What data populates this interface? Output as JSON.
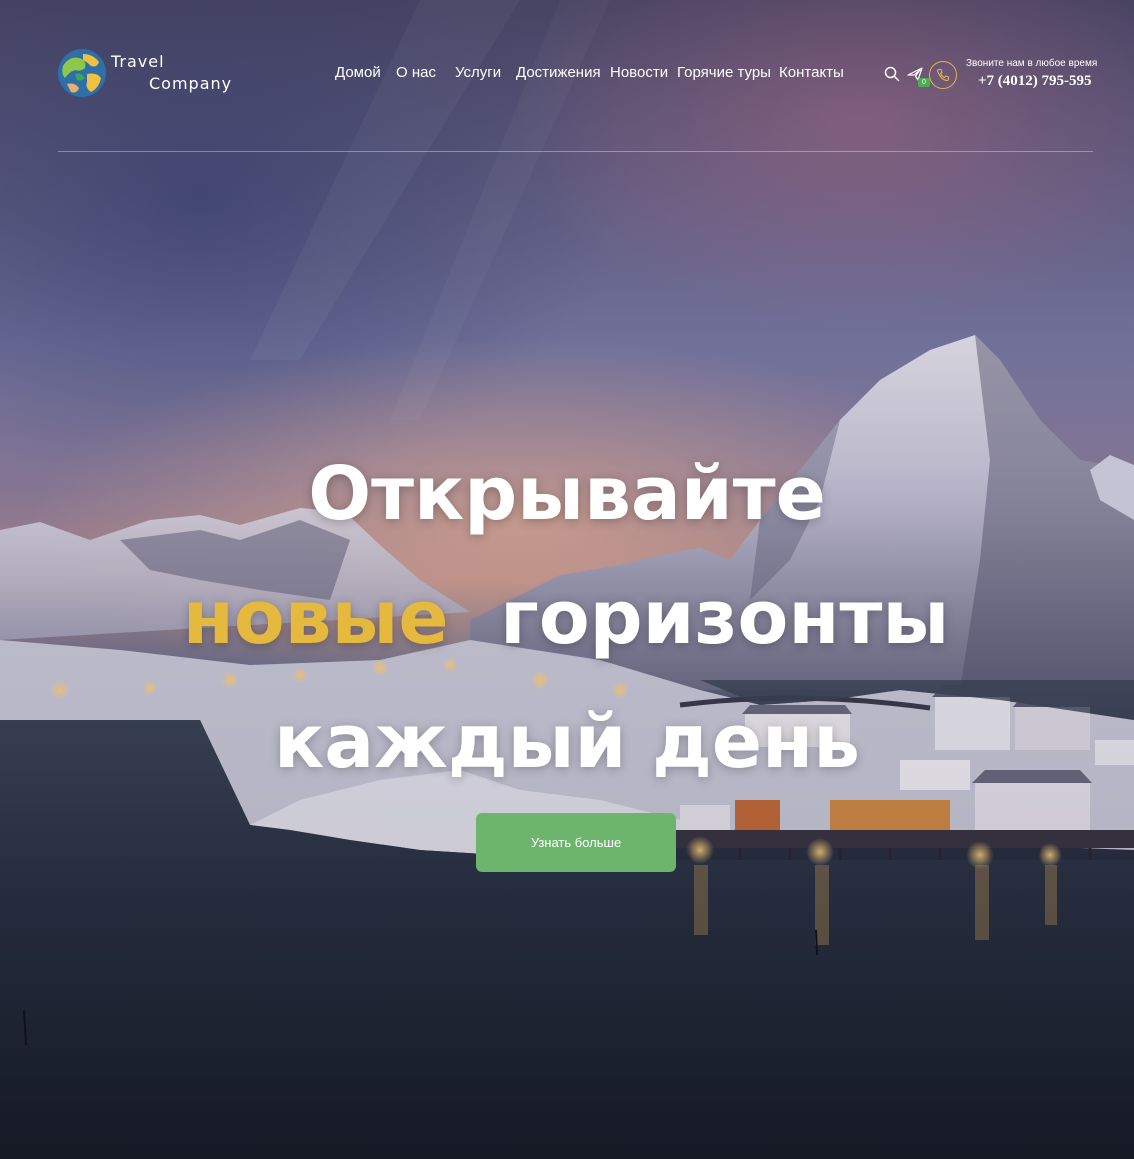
{
  "brand": {
    "name_line1": "Travel",
    "name_line2": "Company"
  },
  "nav": {
    "items": [
      {
        "label": "Домой"
      },
      {
        "label": "О нас"
      },
      {
        "label": "Услуги"
      },
      {
        "label": "Достижения"
      },
      {
        "label": "Новости"
      },
      {
        "label": "Горячие туры"
      },
      {
        "label": "Контакты"
      }
    ]
  },
  "header_actions": {
    "icons": [
      "search-icon",
      "plane-icon",
      "phone-icon"
    ],
    "cart_badge": "0",
    "call_caption": "Звоните нам в любое время",
    "call_number": "+7 (4012) 795-595"
  },
  "hero": {
    "line1": "Открывайте",
    "line2_accent": "новые",
    "line2_rest": "горизонты",
    "line3": "каждый день",
    "cta_label": "Узнать больше"
  },
  "colors": {
    "accent_gold": "#e5b93e",
    "cta_green": "#6db46d",
    "badge_green": "#4cae4f",
    "phone_ring": "#d9b84a"
  }
}
